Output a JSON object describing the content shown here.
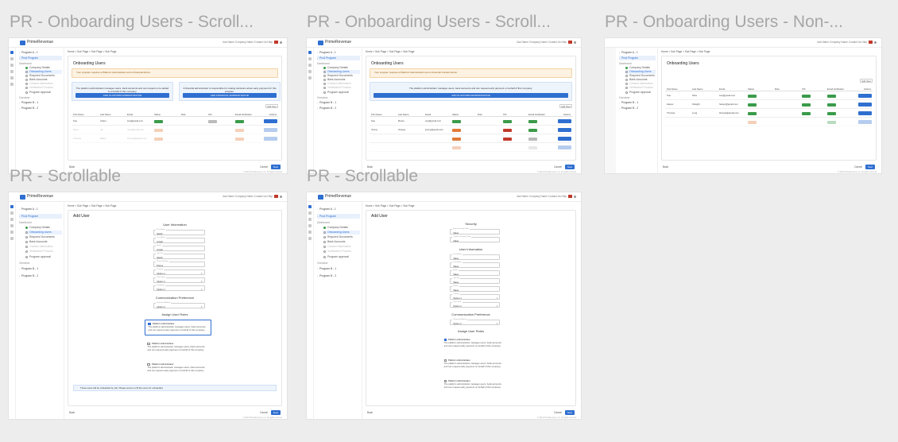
{
  "frames": [
    {
      "title": "PR - Onboarding Users - Scroll...",
      "page_title": "Onboarding Users",
      "warning": "Your program requires a Platform Administrator and a Financial Admin.",
      "notice_left": "The platform administrator manages users, bank accounts and can request to be added to a behalf of this company.",
      "notice_left_btn": "ADD PLATFORM ADMINISTRATOR",
      "notice_right": "A financial administrator is responsible for making decisions about early payment for this program.",
      "notice_right_btn": "ADD FINANCIAL ADMINISTRATOR",
      "add_user": "Add User",
      "columns": [
        "First Name",
        "Last Name",
        "Email",
        "Status",
        "Role",
        "IVS",
        "Email Verification",
        "Actions"
      ],
      "rows": [
        {
          "first": "Sue",
          "last": "Carter",
          "email": "sue@gmail.com"
        },
        {
          "first": "Ryan",
          "last": "Ian",
          "email": "ryan@gmail.com"
        },
        {
          "first": "Thomas",
          "last": "Bailey",
          "email": "thomas@gmail.com"
        }
      ]
    },
    {
      "title": "PR - Onboarding Users - Scroll...",
      "page_title": "Onboarding Users",
      "warning": "Your program requires a Platform Administrator and a Financial Contact Admin.",
      "notice": "The platform administrator manages users, bank accounts and can request early payment on behalf of this company.",
      "notice_btn": "ADD PLATFORM ADMINISTRATOR",
      "add_user": "Add User",
      "columns": [
        "First Name",
        "Last Name",
        "Email",
        "Status",
        "Role",
        "IVS",
        "Email Verification",
        "Actions"
      ],
      "rows": [
        {
          "first": "Sue",
          "last": "Moore",
          "email": "sue@gmail.com"
        },
        {
          "first": "Jimmy",
          "last": "Orange",
          "email": "jimmy@gmail.com"
        },
        {
          "first": "",
          "last": "",
          "email": ""
        },
        {
          "first": "",
          "last": "",
          "email": ""
        }
      ]
    },
    {
      "title": "PR - Onboarding Users - Non-...",
      "page_title": "Onboarding Users",
      "add_user": "Add User",
      "columns": [
        "First Name",
        "Last Name",
        "Email",
        "Status",
        "Role",
        "IVS",
        "Email Verification",
        "Actions"
      ],
      "rows": [
        {
          "first": "Sue",
          "last": "Kline",
          "email": "sue@gmail.com"
        },
        {
          "first": "Harper",
          "last": "Straight",
          "email": "harper@gmail.com"
        },
        {
          "first": "Thomas",
          "last": "Long",
          "email": "thomas@gmail.com"
        },
        {
          "first": "",
          "last": "",
          "email": ""
        }
      ]
    },
    {
      "title": "PR - Scrollable",
      "page_title": "Add User",
      "section_user": "User Information",
      "fields": [
        {
          "label": "First Name",
          "value": "Sarah"
        },
        {
          "label": "Last Name",
          "value": "Ansell"
        },
        {
          "label": "Email",
          "value": "Ansell"
        },
        {
          "label": "Job Title",
          "value": "Sarah"
        },
        {
          "label": "Phone Number",
          "value": "Phone"
        },
        {
          "label": "Country",
          "value": "Option 1"
        },
        {
          "label": "Time Zone",
          "value": "Option 1"
        },
        {
          "label": "Language",
          "value": "Option 1"
        }
      ],
      "section_comm": "Communication Preference",
      "comm_field": {
        "label": "Preferred Method",
        "value": "Option 1"
      },
      "section_roles": "Assign User Roles",
      "roles": [
        {
          "name": "Platform Administrator",
          "desc": "The platform administrator manages users, bank accounts and can request early payment on behalf of this company."
        },
        {
          "name": "Platform Administrator",
          "desc": "The platform administrator manages users, bank accounts and can request early payment on behalf of this company."
        },
        {
          "name": "Platform Administrator",
          "desc": "The platform administrator manages users, bank accounts and can request early payment on behalf of this company."
        }
      ],
      "info": "These users will be onboarded by Job. Please ensure to fill the users for onboarded."
    },
    {
      "title": "PR - Scrollable",
      "page_title": "Add User",
      "section_security": "Security",
      "security_fields": [
        {
          "label": "Enter Security Code",
          "value": "Value"
        },
        {
          "label": "Confirm Security Code",
          "value": "Value"
        }
      ],
      "section_user": "User Information",
      "fields": [
        {
          "label": "First Name",
          "value": "Value"
        },
        {
          "label": "Last Name",
          "value": "Value"
        },
        {
          "label": "Email",
          "value": "Value"
        },
        {
          "label": "Job Title",
          "value": "Value"
        },
        {
          "label": "Phone",
          "value": "Value"
        },
        {
          "label": "Country",
          "value": "Option 1"
        },
        {
          "label": "Time Zone",
          "value": "Option 1"
        }
      ],
      "section_comm": "Communication Preference",
      "comm_field": {
        "label": "Preferred Method",
        "value": "Option 1"
      },
      "section_roles": "Assign User Roles",
      "roles": [
        {
          "name": "Platform Administrator",
          "desc": "The platform administrator manages users, bank accounts and can request early payment on behalf of this company."
        },
        {
          "name": "Platform Administrator",
          "desc": "The platform administrator manages users, bank accounts and can request early payment on behalf of this company."
        },
        {
          "name": "Platform Administrator",
          "desc": "The platform administrator manages users, bank accounts and can request early payment on behalf of this company."
        }
      ]
    }
  ],
  "shared": {
    "brand": "PrimeRevenue",
    "crumbs": "Home  >  Sub Page  >  Sub Page  >  Sub Page",
    "topright": "Ask Name   Company Name   Contact Us   Help",
    "back": "Back",
    "cancel": "Cancel",
    "next": "Next",
    "copyright": "© 2024 PrimeRevenue, Inc. All rights reserved",
    "sidebar_programs": [
      "Program A - 1",
      "Program B - 2"
    ],
    "sidebar_active": "Prod Program",
    "sidebar_dashboard": "Dashboard",
    "sidebar_steps": [
      "Company Details",
      "Onboarding Users",
      "Required Documents",
      "Bank Accounts",
      "Contact Information",
      "Verification Process"
    ],
    "sidebar_link": "Program approval",
    "sidebar_overview": "Overview",
    "sidebar_bottom": [
      "Program B - 1",
      "Program B - 2"
    ]
  },
  "colors": {
    "accent": "#2f6fd0",
    "success": "#3a9b4a",
    "warning": "#e07b39",
    "error": "#c0392b"
  }
}
